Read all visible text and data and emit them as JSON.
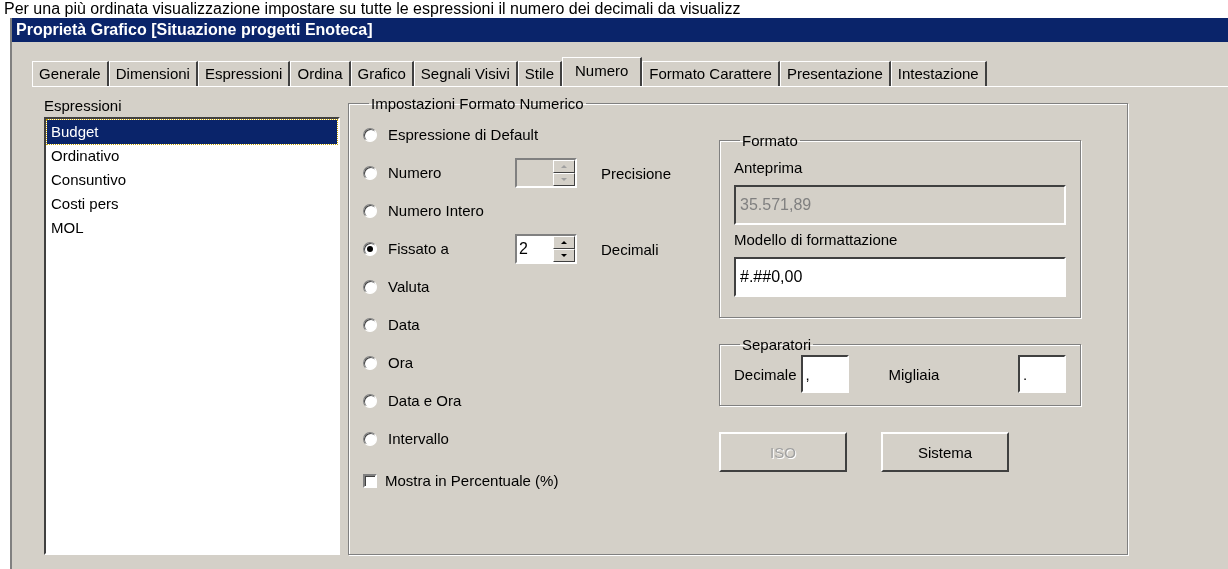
{
  "caption": "Per una più ordinata visualizzazione impostare su tutte le espressioni il numero dei decimali da visualizz",
  "window": {
    "title": "Proprietà Grafico [Situazione progetti Enoteca]"
  },
  "tabs": [
    {
      "label": "Generale",
      "selected": false
    },
    {
      "label": "Dimensioni",
      "selected": false
    },
    {
      "label": "Espressioni",
      "selected": false
    },
    {
      "label": "Ordina",
      "selected": false
    },
    {
      "label": "Grafico",
      "selected": false
    },
    {
      "label": "Segnali Visivi",
      "selected": false
    },
    {
      "label": "Stile",
      "selected": false
    },
    {
      "label": "Numero",
      "selected": true
    },
    {
      "label": "Formato Carattere",
      "selected": false
    },
    {
      "label": "Presentazione",
      "selected": false
    },
    {
      "label": "Intestazione",
      "selected": false
    }
  ],
  "expressions": {
    "label": "Espressioni",
    "items": [
      {
        "label": "Budget",
        "selected": true
      },
      {
        "label": "Ordinativo",
        "selected": false
      },
      {
        "label": "Consuntivo",
        "selected": false
      },
      {
        "label": "Costi pers",
        "selected": false
      },
      {
        "label": "MOL",
        "selected": false
      }
    ]
  },
  "number_format": {
    "title": "Impostazioni Formato Numerico",
    "options": [
      {
        "kind": "plain",
        "label": "Espressione di Default",
        "selected": false
      },
      {
        "kind": "spin",
        "label": "Numero",
        "selected": false,
        "spin": {
          "disabled": true
        },
        "suffix": "Precisione"
      },
      {
        "kind": "plain",
        "label": "Numero Intero",
        "selected": false
      },
      {
        "kind": "spin",
        "label": "Fissato a",
        "selected": true,
        "spin": {
          "value": "2",
          "disabled": false
        },
        "suffix": "Decimali"
      },
      {
        "kind": "plain",
        "label": "Valuta",
        "selected": false
      },
      {
        "kind": "plain",
        "label": "Data",
        "selected": false
      },
      {
        "kind": "plain",
        "label": "Ora",
        "selected": false
      },
      {
        "kind": "plain",
        "label": "Data e Ora",
        "selected": false
      },
      {
        "kind": "plain",
        "label": "Intervallo",
        "selected": false
      }
    ],
    "percent_checkbox": {
      "label": "Mostra in Percentuale (%)",
      "checked": false
    }
  },
  "format": {
    "title": "Formato",
    "preview_label": "Anteprima",
    "preview": {
      "value": "35.571,89",
      "disabled": true
    },
    "pattern_label": "Modello di formattazione",
    "pattern": {
      "value": "#.##0,00",
      "disabled": false
    }
  },
  "separators": {
    "title": "Separatori",
    "fields": [
      {
        "label": "Decimale",
        "value": ","
      },
      {
        "label": "Migliaia",
        "value": "."
      }
    ]
  },
  "buttons": [
    {
      "label": "ISO",
      "disabled": true
    },
    {
      "label": "Sistema",
      "disabled": false
    }
  ]
}
